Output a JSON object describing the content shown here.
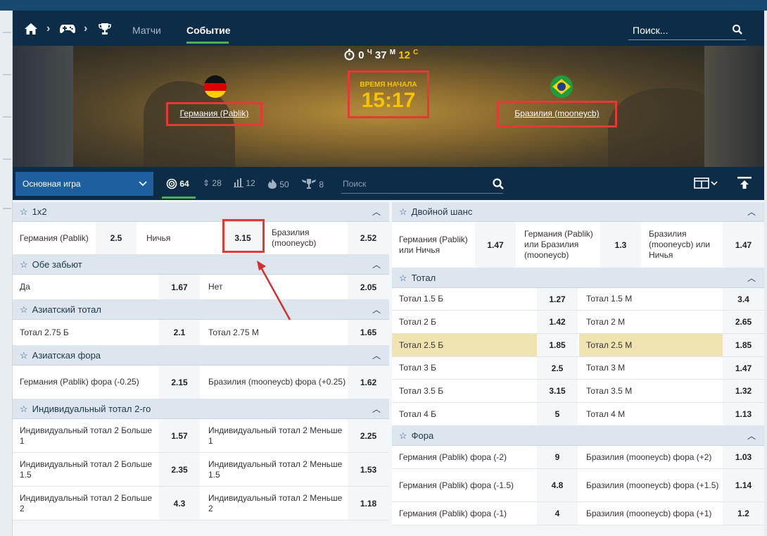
{
  "nav": {
    "matches_label": "Матчи",
    "event_label": "Событие",
    "search_placeholder": "Поиск..."
  },
  "banner": {
    "timer": {
      "h": "0",
      "h_unit": "Ч",
      "m": "37",
      "m_unit": "М",
      "s": "12",
      "s_unit": "С"
    },
    "start_label": "ВРЕМЯ НАЧАЛА",
    "start_time": "15:17",
    "team1": "Германия (Pablik)",
    "team2": "Бразилия (mooneycb)"
  },
  "toolbar": {
    "select_label": "Основная игра",
    "filters": [
      "64",
      "28",
      "12",
      "50",
      "8"
    ],
    "search_placeholder": "Поиск"
  },
  "left": {
    "m1x2": {
      "title": "1x2",
      "row": [
        [
          "Германия (Pablik)",
          "2.5"
        ],
        [
          "Ничья",
          "3.15"
        ],
        [
          "Бразилия (mooneycb)",
          "2.52"
        ]
      ]
    },
    "both": {
      "title": "Обе забьют",
      "row": [
        [
          "Да",
          "1.67"
        ],
        [
          "Нет",
          "2.05"
        ]
      ]
    },
    "asian_total": {
      "title": "Азиатский тотал",
      "row": [
        [
          "Тотал 2.75 Б",
          "2.1"
        ],
        [
          "Тотал 2.75 М",
          "1.65"
        ]
      ]
    },
    "asian_hcp": {
      "title": "Азиатская фора",
      "row": [
        [
          "Германия (Pablik) фора (-0.25)",
          "2.15"
        ],
        [
          "Бразилия (mooneycb) фора (+0.25)",
          "1.62"
        ]
      ]
    },
    "ind_total": {
      "title": "Индивидуальный тотал 2-го",
      "rows": [
        [
          [
            "Индивидуальный тотал 2 Больше 1",
            "1.57"
          ],
          [
            "Индивидуальный тотал 2 Меньше 1",
            "2.25"
          ]
        ],
        [
          [
            "Индивидуальный тотал 2 Больше 1.5",
            "2.35"
          ],
          [
            "Индивидуальный тотал 2 Меньше 1.5",
            "1.53"
          ]
        ],
        [
          [
            "Индивидуальный тотал 2 Больше 2",
            "4.3"
          ],
          [
            "Индивидуальный тотал 2 Меньше 2",
            "1.18"
          ]
        ]
      ]
    }
  },
  "right": {
    "double": {
      "title": "Двойной шанс",
      "row": [
        [
          "Германия (Pablik) или Ничья",
          "1.47"
        ],
        [
          "Германия (Pablik) или Бразилия (mooneycb)",
          "1.3"
        ],
        [
          "Бразилия (mooneycb) или Ничья",
          "1.47"
        ]
      ]
    },
    "total": {
      "title": "Тотал",
      "rows": [
        [
          [
            "Тотал 1.5 Б",
            "1.27"
          ],
          [
            "Тотал 1.5 М",
            "3.4"
          ]
        ],
        [
          [
            "Тотал 2 Б",
            "1.42"
          ],
          [
            "Тотал 2 М",
            "2.65"
          ]
        ],
        [
          [
            "Тотал 2.5 Б",
            "1.85"
          ],
          [
            "Тотал 2.5 М",
            "1.85"
          ]
        ],
        [
          [
            "Тотал 3 Б",
            "2.5"
          ],
          [
            "Тотал 3 М",
            "1.47"
          ]
        ],
        [
          [
            "Тотал 3.5 Б",
            "3.15"
          ],
          [
            "Тотал 3.5 М",
            "1.32"
          ]
        ],
        [
          [
            "Тотал 4 Б",
            "5"
          ],
          [
            "Тотал 4 М",
            "1.13"
          ]
        ]
      ]
    },
    "hcp": {
      "title": "Фора",
      "rows": [
        [
          [
            "Германия (Pablik) фора (-2)",
            "9"
          ],
          [
            "Бразилия (mooneycb) фора (+2)",
            "1.03"
          ]
        ],
        [
          [
            "Германия (Pablik) фора (-1.5)",
            "4.8"
          ],
          [
            "Бразилия (mooneycb) фора (+1.5)",
            "1.14"
          ]
        ],
        [
          [
            "Германия (Pablik) фора (-1)",
            "4"
          ],
          [
            "Бразилия (mooneycb) фора (+1)",
            "1.2"
          ]
        ]
      ]
    }
  },
  "colors": {
    "nav_bg": "#0d2c47",
    "accent_green": "#4caf50",
    "select_blue": "#1e5fa0",
    "highlight_red": "#e53935",
    "timer_yellow": "#f5c400",
    "row_highlight": "#efe3b1"
  }
}
